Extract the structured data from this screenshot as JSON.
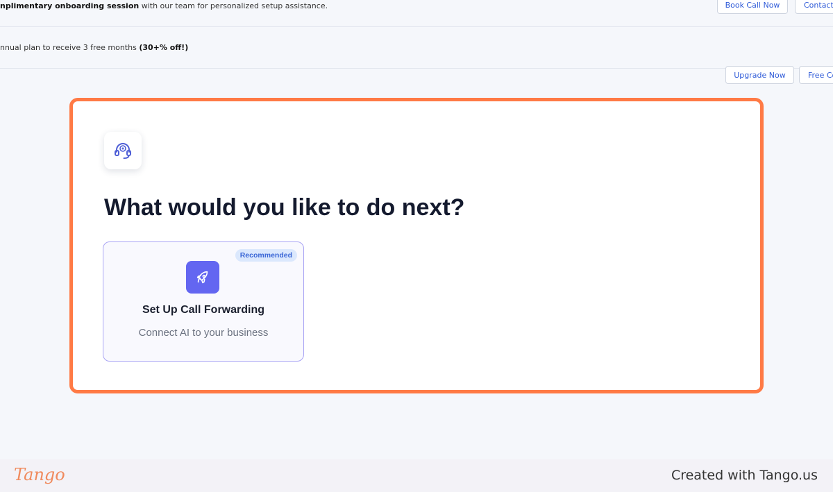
{
  "banners": {
    "onboarding": {
      "bold_text": "nplimentary onboarding session",
      "text": " with our team for personalized setup assistance.",
      "book_call_label": "Book Call Now",
      "contact_label": "Contact"
    },
    "upgrade": {
      "text": "nnual plan to receive 3 free months ",
      "bold_text": "(30+% off!)",
      "upgrade_label": "Upgrade Now",
      "free_label": "Free Co"
    }
  },
  "main": {
    "icon": "headset-support-icon",
    "heading": "What would you like to do next?",
    "option": {
      "badge": "Recommended",
      "icon": "rocket-icon",
      "title": "Set Up Call Forwarding",
      "subtitle": "Connect AI to your business"
    }
  },
  "footer": {
    "logo": "Tango",
    "credit": "Created with Tango.us"
  },
  "colors": {
    "highlight_border": "#ff7a45",
    "accent": "#6366f1",
    "badge_bg": "#dbe8fd",
    "link_blue": "#2f5bd8"
  }
}
